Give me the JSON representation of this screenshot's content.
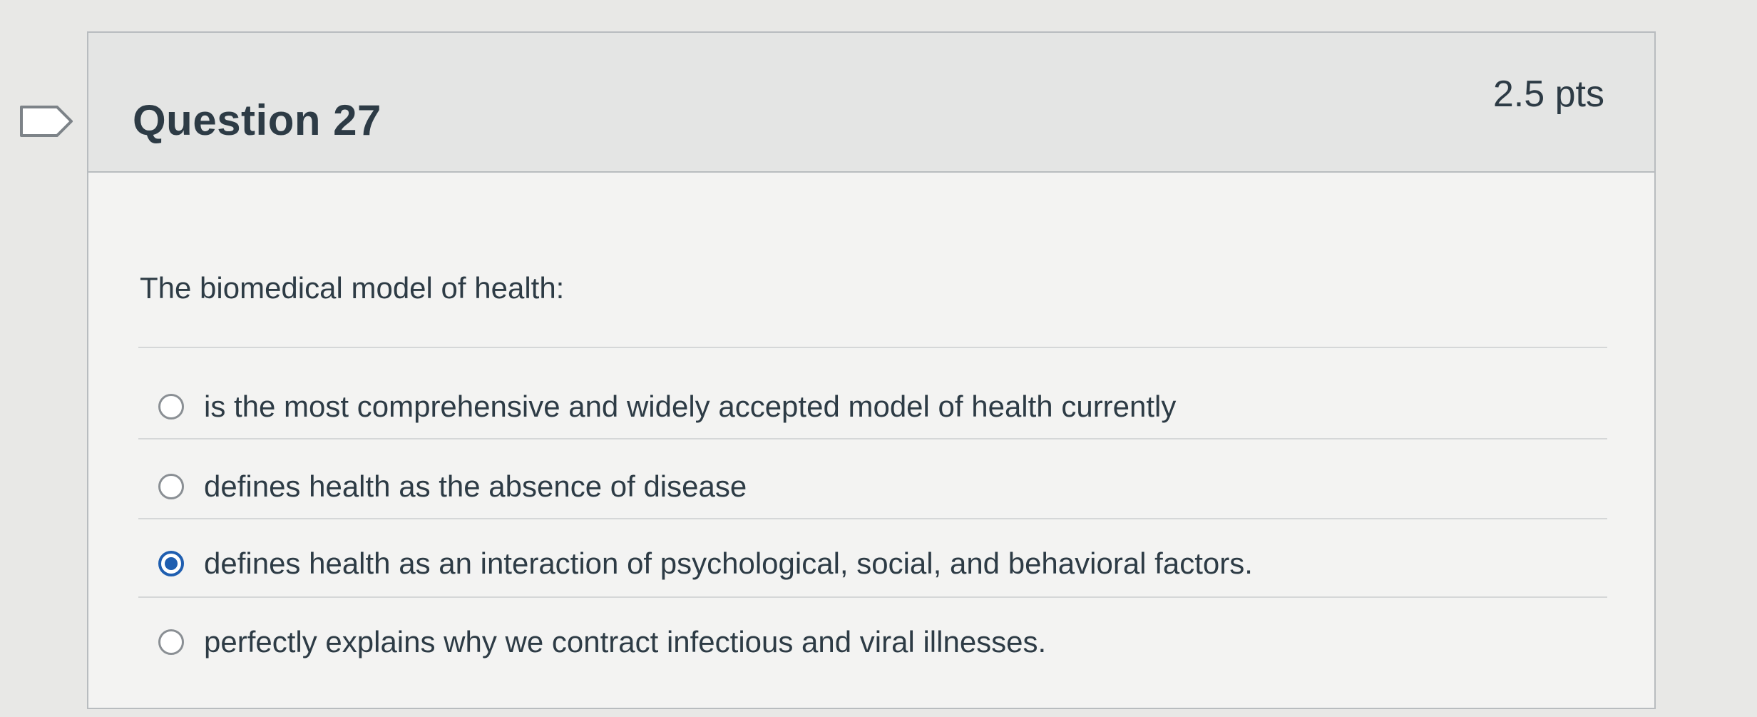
{
  "question": {
    "title": "Question 27",
    "points": "2.5 pts",
    "text": "The biomedical model of health:",
    "flag_icon": "bookmark-flag-icon"
  },
  "answers": [
    {
      "label": "is the most comprehensive and widely accepted model of health currently",
      "selected": false
    },
    {
      "label": "defines health as the absence of disease",
      "selected": false
    },
    {
      "label": "defines health as an interaction of psychological, social, and behavioral factors.",
      "selected": true
    },
    {
      "label": "perfectly explains why we contract infectious and viral illnesses.",
      "selected": false
    }
  ],
  "colors": {
    "accent": "#1f5eb0",
    "text": "#2d3b45",
    "border": "#b8bcbf",
    "header_bg": "#e4e5e4"
  }
}
